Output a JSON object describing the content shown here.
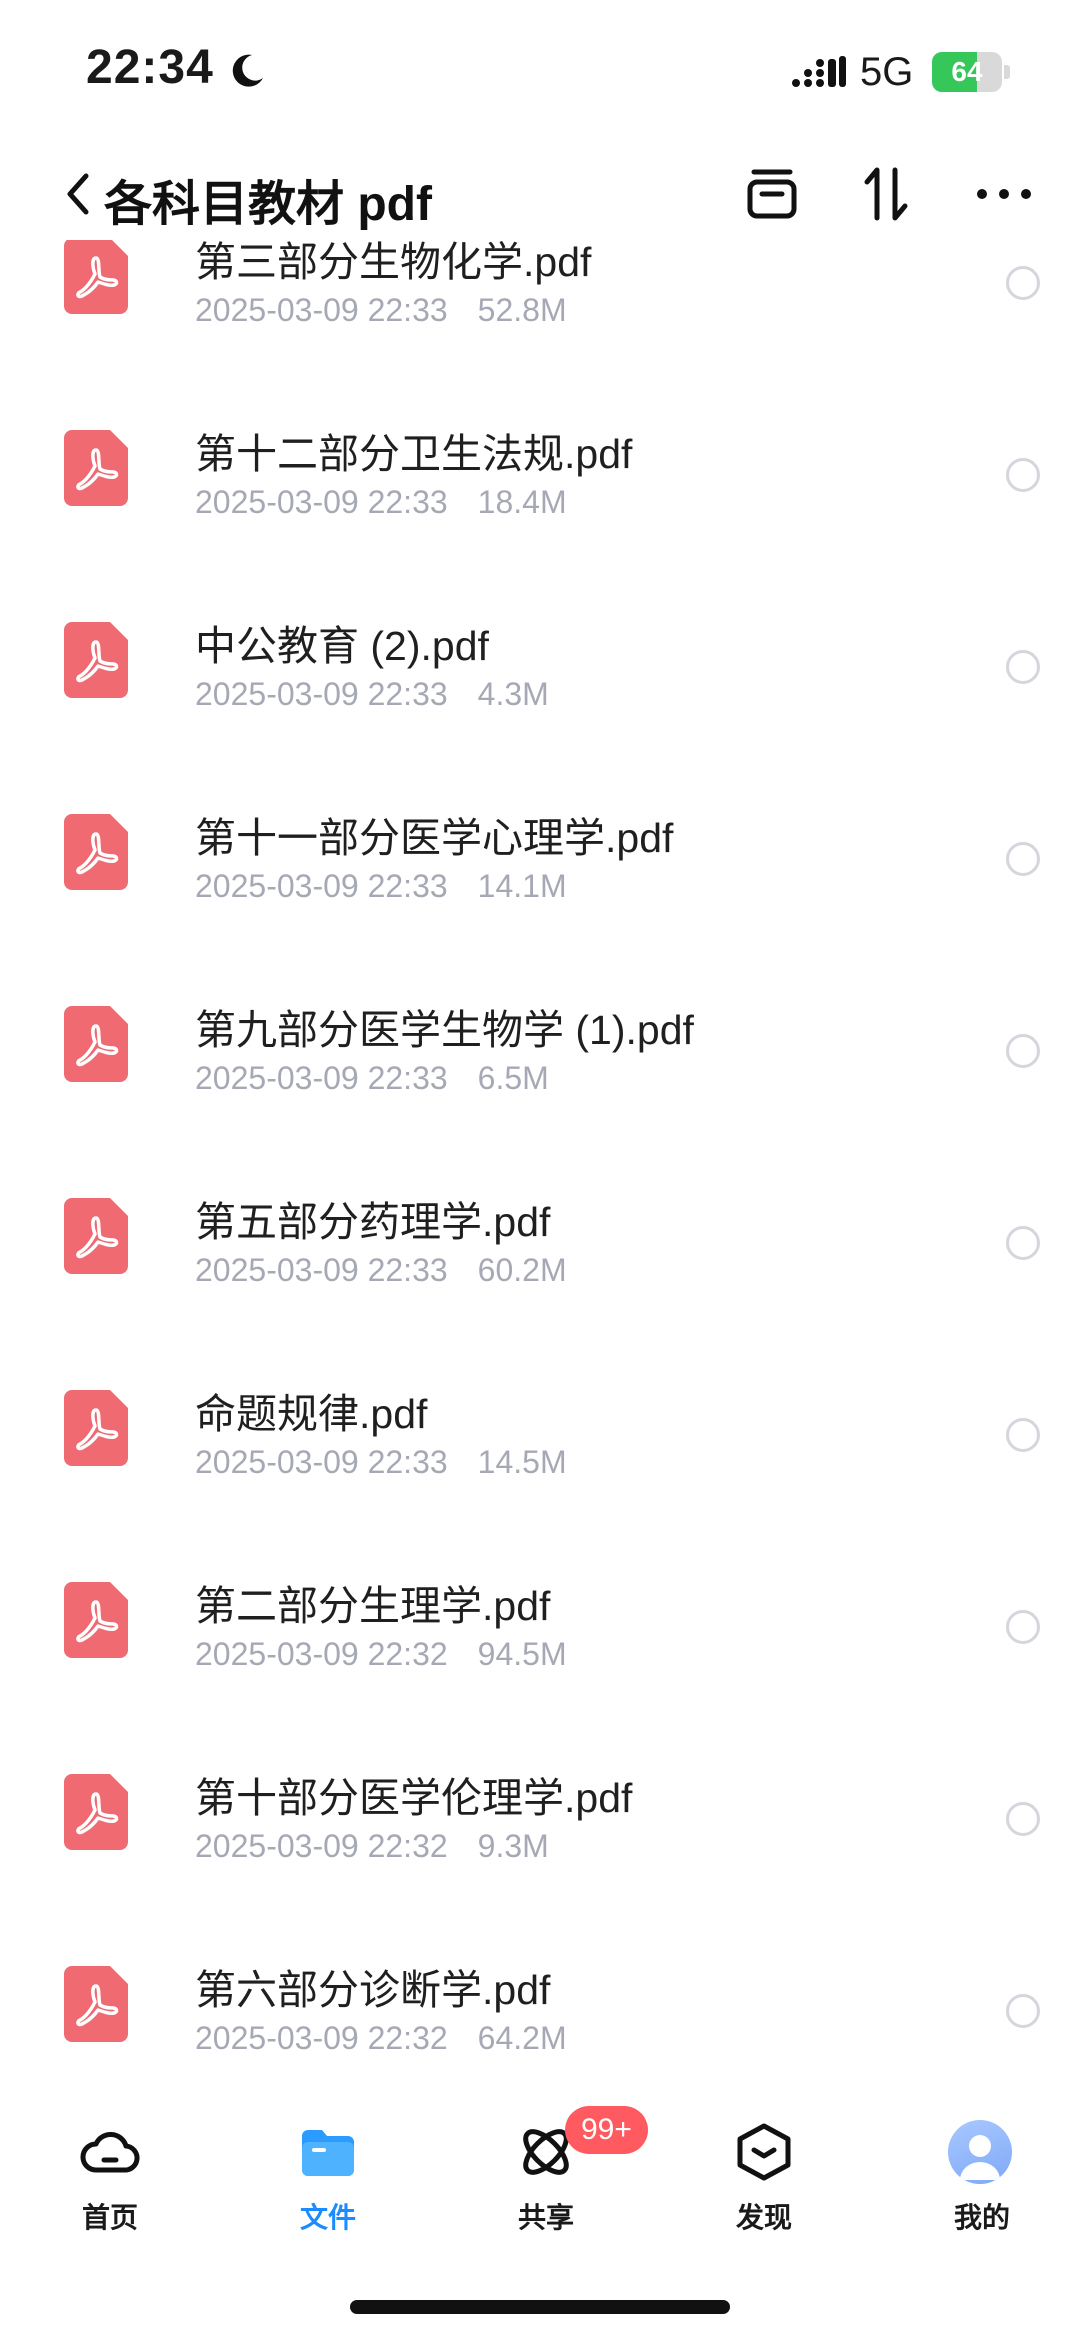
{
  "status_bar": {
    "time": "22:34",
    "network": "5G",
    "battery_percent": 64,
    "battery_label": "64"
  },
  "header": {
    "title": "各科目教材 pdf"
  },
  "files": [
    {
      "name": "第三部分生物化学.pdf",
      "date": "2025-03-09 22:33",
      "size": "52.8M"
    },
    {
      "name": "第十二部分卫生法规.pdf",
      "date": "2025-03-09 22:33",
      "size": "18.4M"
    },
    {
      "name": "中公教育 (2).pdf",
      "date": "2025-03-09 22:33",
      "size": "4.3M"
    },
    {
      "name": "第十一部分医学心理学.pdf",
      "date": "2025-03-09 22:33",
      "size": "14.1M"
    },
    {
      "name": "第九部分医学生物学 (1).pdf",
      "date": "2025-03-09 22:33",
      "size": "6.5M"
    },
    {
      "name": "第五部分药理学.pdf",
      "date": "2025-03-09 22:33",
      "size": "60.2M"
    },
    {
      "name": "命题规律.pdf",
      "date": "2025-03-09 22:33",
      "size": "14.5M"
    },
    {
      "name": "第二部分生理学.pdf",
      "date": "2025-03-09 22:32",
      "size": "94.5M"
    },
    {
      "name": "第十部分医学伦理学.pdf",
      "date": "2025-03-09 22:32",
      "size": "9.3M"
    },
    {
      "name": "第六部分诊断学.pdf",
      "date": "2025-03-09 22:32",
      "size": "64.2M"
    }
  ],
  "tabs": [
    {
      "label": "首页",
      "icon": "cloud-icon",
      "active": false
    },
    {
      "label": "文件",
      "icon": "folder-icon",
      "active": true
    },
    {
      "label": "共享",
      "icon": "orbit-icon",
      "active": false,
      "badge": "99+"
    },
    {
      "label": "发现",
      "icon": "box-icon",
      "active": false
    },
    {
      "label": "我的",
      "icon": "avatar-icon",
      "active": false
    }
  ],
  "colors": {
    "accent": "#1a8cff",
    "pdf_icon": "#f06a72",
    "badge": "#ff5a5f",
    "meta_text": "#a6a9b5",
    "battery": "#35c759"
  }
}
